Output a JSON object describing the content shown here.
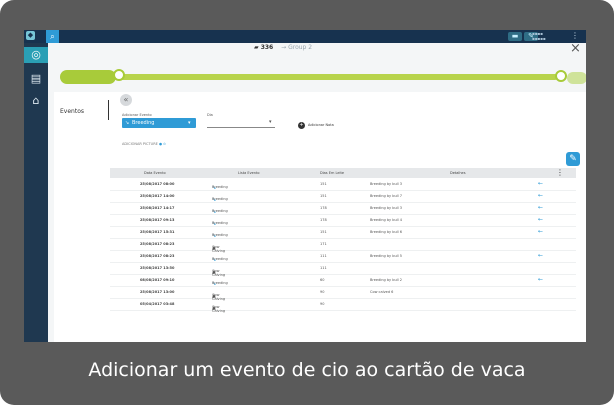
{
  "header": {
    "cow_id": "▰ 336",
    "group": "→ Group 2",
    "close": "×"
  },
  "timeline": {
    "pill_text": "",
    "bar_label": "",
    "tail_text": ""
  },
  "nav": {
    "title": "Eventos",
    "items": [
      "",
      "",
      "",
      ""
    ]
  },
  "form": {
    "event_label": "Adicionar Evento",
    "event_value": "Breeding",
    "day_label": "Dia",
    "day_value": "",
    "add_label": "Adicionar Nota",
    "meta": "ADICIONAR PICTURE"
  },
  "table": {
    "columns": [
      "Data Evento",
      "Lista Evento",
      "Dias Em Leite",
      "Detalhes"
    ],
    "rows": [
      {
        "date": "25/08/2017 08:00",
        "event": "Breeding",
        "icon": "breeding",
        "dim": "151",
        "detail": "Breeding by bull 3",
        "arrow": true
      },
      {
        "date": "25/08/2017 14:00",
        "event": "Breeding",
        "icon": "breeding",
        "dim": "151",
        "detail": "Breeding by bull 7",
        "arrow": true
      },
      {
        "date": "25/08/2017 14:17",
        "event": "Breeding",
        "icon": "breeding",
        "dim": "178",
        "detail": "Breeding by bull 3",
        "arrow": true
      },
      {
        "date": "25/08/2017 09:13",
        "event": "Breeding",
        "icon": "breeding",
        "dim": "178",
        "detail": "Breeding by bull 4",
        "arrow": true
      },
      {
        "date": "25/08/2017 15:31",
        "event": "Breeding",
        "icon": "breeding",
        "dim": "151",
        "detail": "Breeding by bull 6",
        "arrow": true
      },
      {
        "date": "25/08/2017 08:23",
        "event": "Cow Calving",
        "icon": "cow",
        "dim": "171",
        "detail": "",
        "arrow": false
      },
      {
        "date": "25/08/2017 08:23",
        "event": "Breeding",
        "icon": "breeding",
        "dim": "111",
        "detail": "Breeding by bull 5",
        "arrow": true
      },
      {
        "date": "25/08/2017 13:50",
        "event": "Cow Calving",
        "icon": "cow",
        "dim": "111",
        "detail": "",
        "arrow": false
      },
      {
        "date": "08/08/2017 09:10",
        "event": "Breeding",
        "icon": "breeding",
        "dim": "60",
        "detail": "Breeding by bull 2",
        "arrow": true
      },
      {
        "date": "25/08/2017 13:00",
        "event": "Cow Calving",
        "icon": "cow",
        "dim": "90",
        "detail": "Cow calved 6",
        "arrow": false
      },
      {
        "date": "05/04/2017 03:48",
        "event": "Cow Calving",
        "icon": "cow",
        "dim": "90",
        "detail": "",
        "arrow": false
      }
    ]
  },
  "caption": "Adicionar um evento de cio ao cartão de vaca",
  "colors": {
    "accent_blue": "#2f9bd6",
    "timeline_green": "#a8cb3a",
    "nav_dark": "#17324f",
    "sidebar_active": "#2a9fb5",
    "frame_gray": "#5a5a5a"
  }
}
